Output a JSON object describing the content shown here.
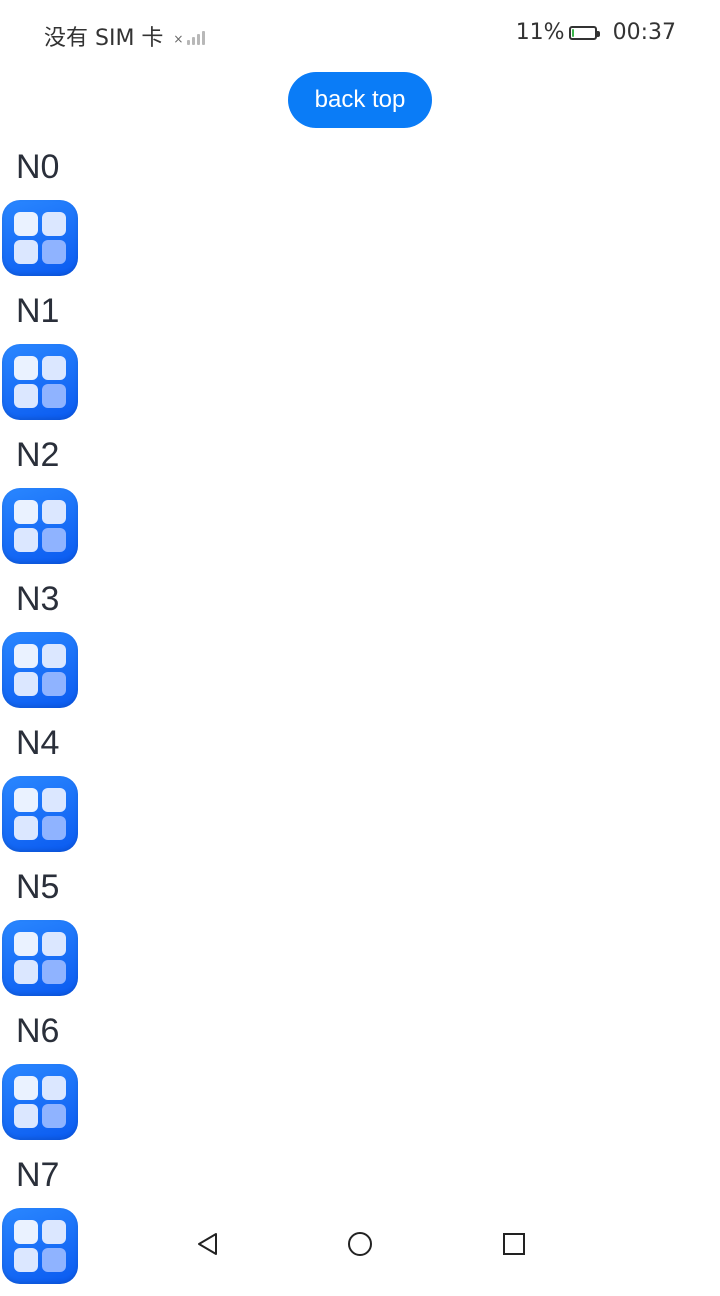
{
  "status_bar": {
    "carrier": "没有 SIM 卡",
    "battery_percent": "11%",
    "battery_level": 0.11,
    "time": "00:37",
    "icons": [
      "signal-icon",
      "battery-icon"
    ]
  },
  "back_top_button": {
    "label": "back top"
  },
  "list": {
    "items": [
      {
        "label": "N0",
        "icon": "app-grid-icon"
      },
      {
        "label": "N1",
        "icon": "app-grid-icon"
      },
      {
        "label": "N2",
        "icon": "app-grid-icon"
      },
      {
        "label": "N3",
        "icon": "app-grid-icon"
      },
      {
        "label": "N4",
        "icon": "app-grid-icon"
      },
      {
        "label": "N5",
        "icon": "app-grid-icon"
      },
      {
        "label": "N6",
        "icon": "app-grid-icon"
      },
      {
        "label": "N7",
        "icon": "app-grid-icon"
      }
    ]
  },
  "nav_bar": {
    "icons": [
      "back-triangle-icon",
      "home-circle-icon",
      "recent-square-icon"
    ]
  },
  "colors": {
    "accent": "#0a7cf7",
    "icon_gradient_start": "#2a87ff",
    "icon_gradient_end": "#0a5af0",
    "battery_fill": "#3bb54a"
  }
}
